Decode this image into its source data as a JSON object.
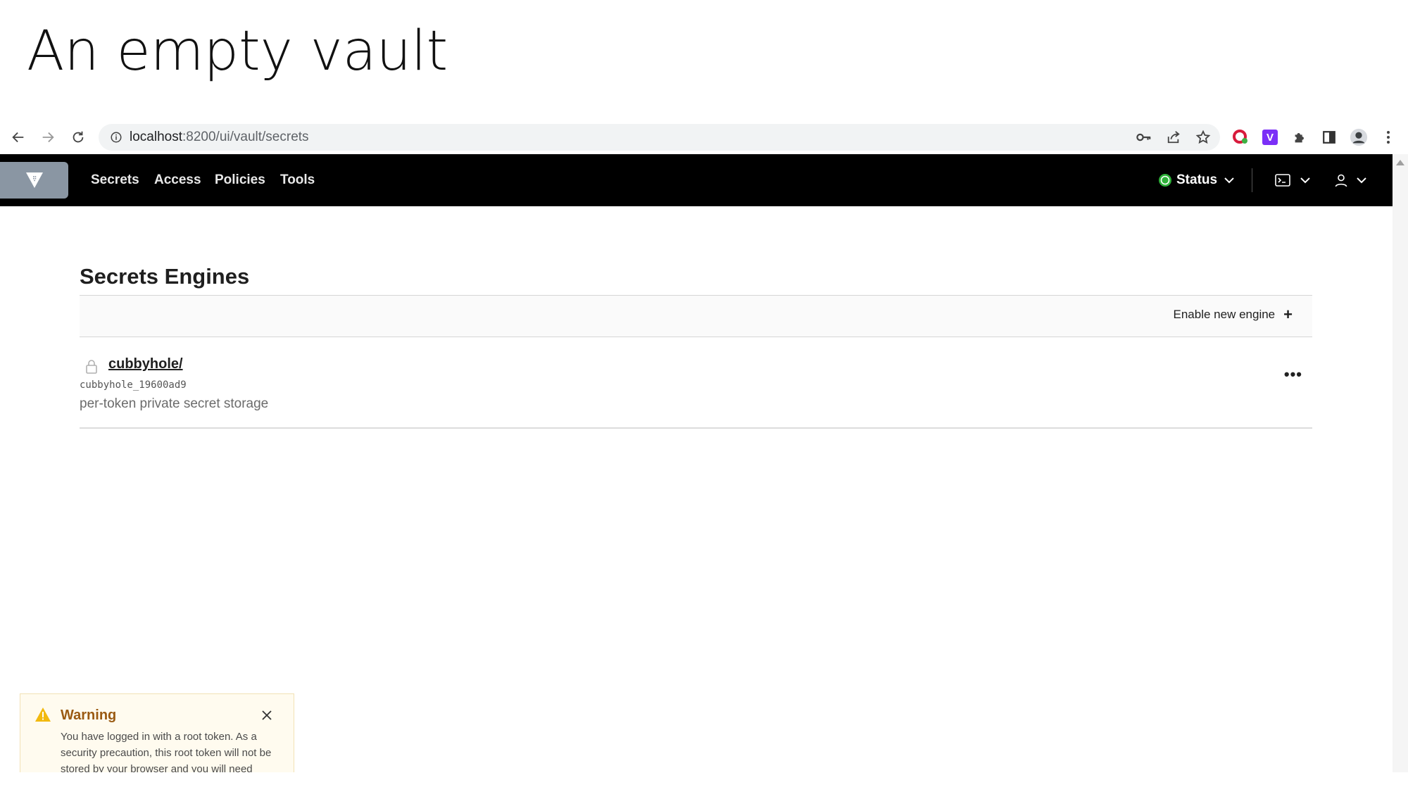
{
  "slide": {
    "title": "An empty vault"
  },
  "browser": {
    "url_host": "localhost",
    "url_path": ":8200/ui/vault/secrets",
    "icons": [
      "back-arrow-icon",
      "forward-arrow-icon",
      "reload-icon",
      "info-icon",
      "key-icon",
      "share-icon",
      "star-icon",
      "extension-red-icon",
      "extension-v-icon",
      "puzzle-icon",
      "side-panel-icon",
      "profile-icon",
      "kebab-menu-icon"
    ],
    "extension_v_label": "V"
  },
  "nav": {
    "links": [
      "Secrets",
      "Access",
      "Policies",
      "Tools"
    ],
    "status_label": "Status",
    "status_color": "#2eb039"
  },
  "page": {
    "title": "Secrets Engines",
    "enable_label": "Enable new engine",
    "enable_icon": "+"
  },
  "engines": [
    {
      "path": "cubbyhole/",
      "accessor": "cubbyhole_19600ad9",
      "description": "per-token private secret storage",
      "menu_label": "•••"
    }
  ],
  "toast": {
    "title": "Warning",
    "body": "You have logged in with a root token. As a security precaution, this root token will not be stored by your browser and you will need",
    "accent_color": "#f2b90f"
  }
}
